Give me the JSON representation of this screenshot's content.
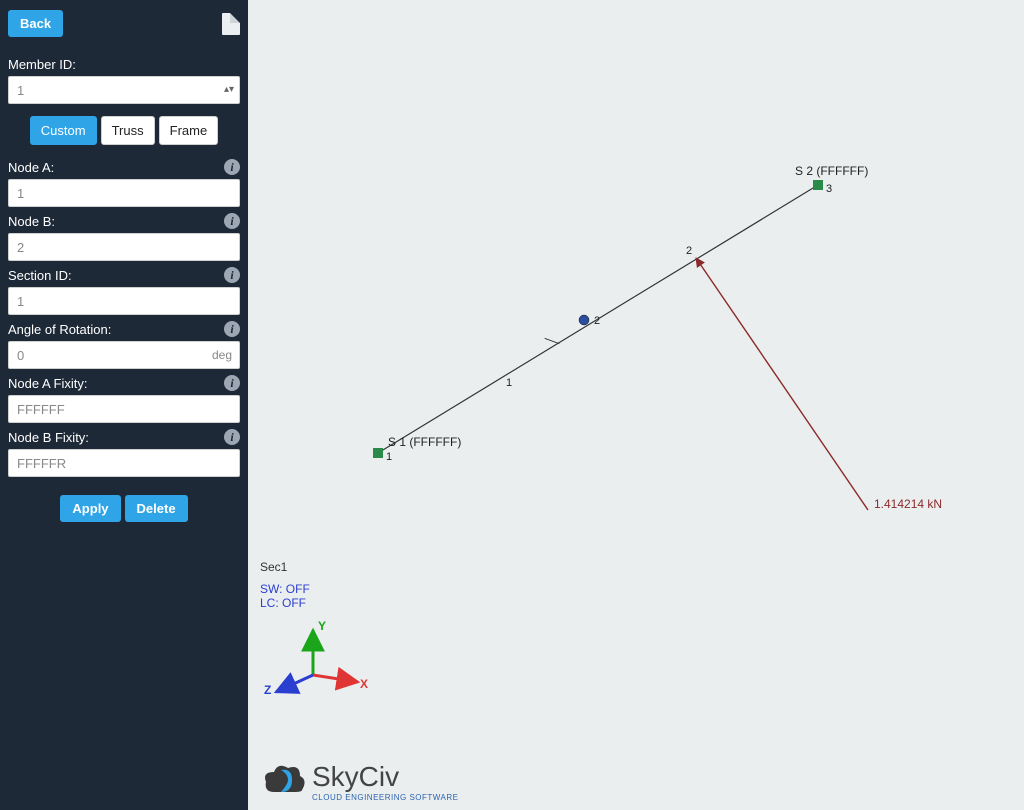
{
  "sidebar": {
    "back_label": "Back",
    "member_id_label": "Member ID:",
    "member_id_value": "1",
    "type_buttons": {
      "custom": "Custom",
      "truss": "Truss",
      "frame": "Frame"
    },
    "node_a_label": "Node A:",
    "node_a_value": "1",
    "node_b_label": "Node B:",
    "node_b_value": "2",
    "section_id_label": "Section ID:",
    "section_id_value": "1",
    "angle_label": "Angle of Rotation:",
    "angle_value": "0",
    "angle_unit": "deg",
    "fixity_a_label": "Node A Fixity:",
    "fixity_a_value": "FFFFFF",
    "fixity_b_label": "Node B Fixity:",
    "fixity_b_value": "FFFFFR",
    "apply_label": "Apply",
    "delete_label": "Delete"
  },
  "canvas": {
    "section_legend": "Sec1",
    "sw_status": "SW: OFF",
    "lc_status": "LC: OFF",
    "axes": {
      "x": "X",
      "y": "Y",
      "z": "Z"
    },
    "nodes": [
      {
        "id": "1",
        "label_s": "S 1 (FFFFFF)"
      },
      {
        "id": "2",
        "label_s": ""
      },
      {
        "id": "3",
        "label_s": "S 2 (FFFFFF)"
      }
    ],
    "member_midlabels": {
      "m1": "1",
      "m2": "2"
    },
    "load_label": "1.414214 kN"
  },
  "brand": {
    "name": "SkyCiv",
    "subtitle": "CLOUD ENGINEERING SOFTWARE"
  }
}
